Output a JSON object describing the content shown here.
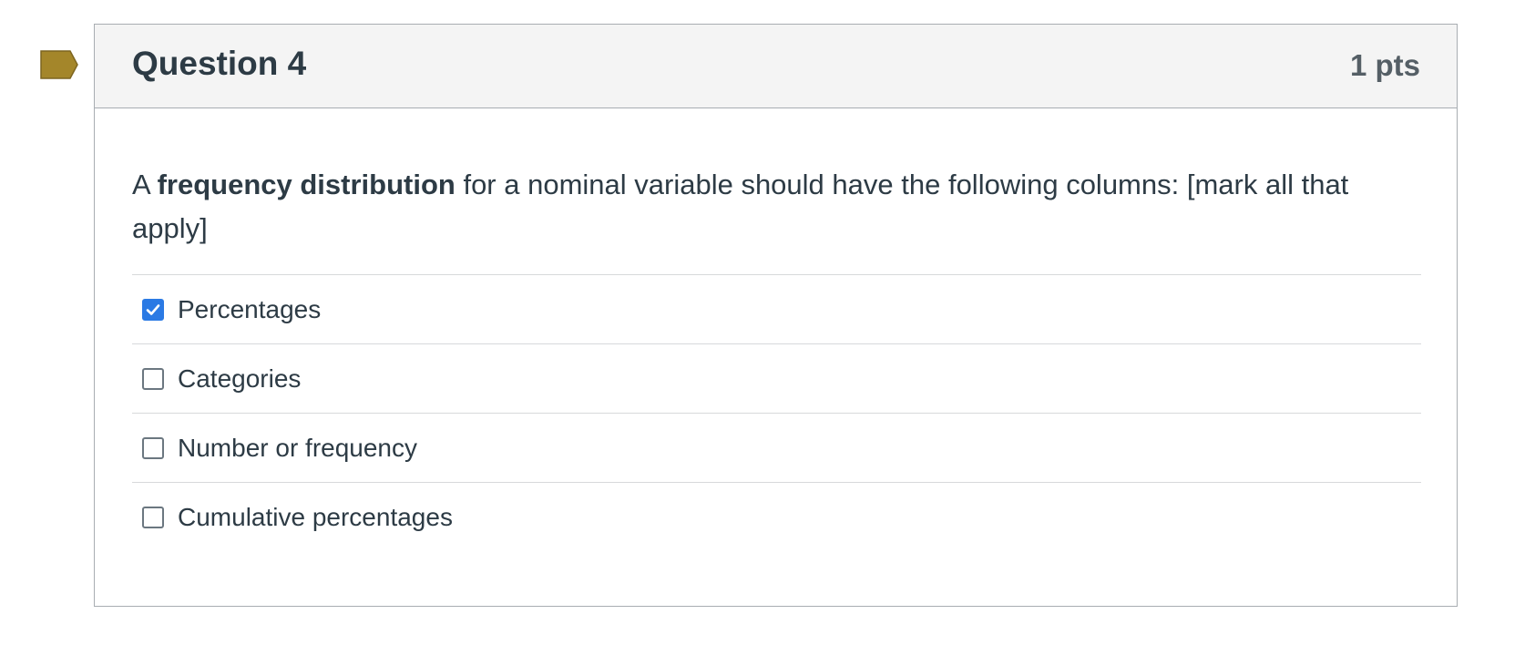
{
  "question": {
    "title": "Question 4",
    "points": "1 pts",
    "text_prefix": "A ",
    "text_bold": "frequency distribution",
    "text_suffix": " for a nominal variable should have the following columns: [mark all that apply]",
    "flag_color": "#a4862a"
  },
  "answers": [
    {
      "label": "Percentages",
      "checked": true
    },
    {
      "label": "Categories",
      "checked": false
    },
    {
      "label": "Number or frequency",
      "checked": false
    },
    {
      "label": "Cumulative percentages",
      "checked": false
    }
  ],
  "colors": {
    "checkbox_checked": "#2b7ae4",
    "text": "#2d3b45",
    "header_bg": "#f4f4f4"
  }
}
